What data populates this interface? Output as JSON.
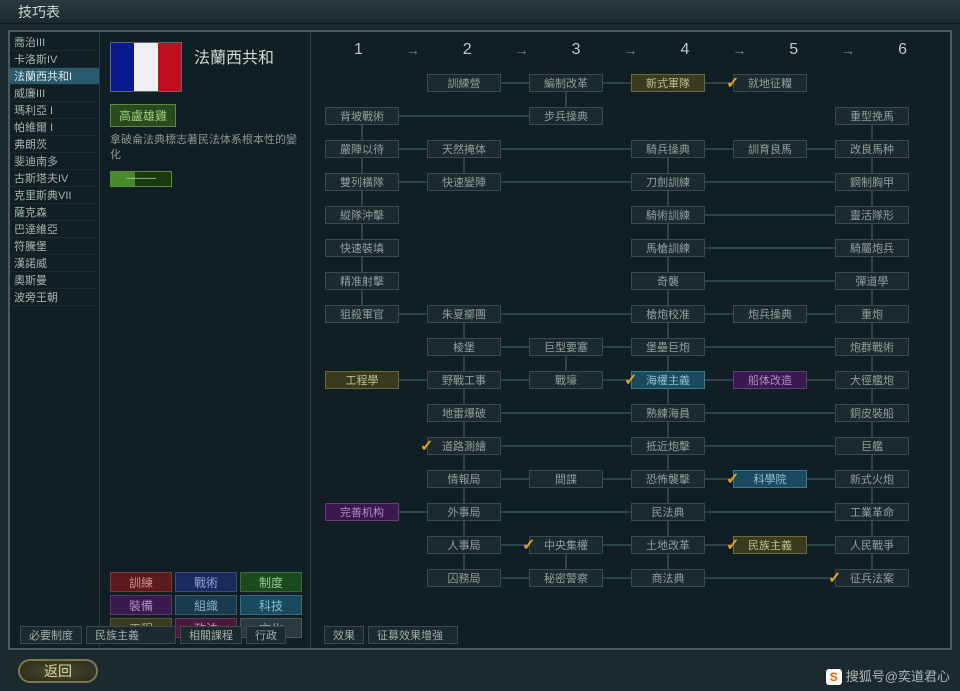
{
  "title": "技巧表",
  "back_label": "返回",
  "watermark": "搜狐号@奕道君心",
  "sidebar": {
    "items": [
      {
        "label": "喬治III"
      },
      {
        "label": "卡洛斯IV"
      },
      {
        "label": "法蘭西共和I",
        "selected": true
      },
      {
        "label": "威廉III"
      },
      {
        "label": "瑪利亞 I"
      },
      {
        "label": "帕維爾 I"
      },
      {
        "label": "弗朗茨"
      },
      {
        "label": "斐迪南多"
      },
      {
        "label": "古斯塔夫IV"
      },
      {
        "label": "克里斯典VII"
      },
      {
        "label": "薩克森"
      },
      {
        "label": "巴達維亞"
      },
      {
        "label": "符騰堡"
      },
      {
        "label": "漢諾威"
      },
      {
        "label": "奧斯曼"
      },
      {
        "label": "波旁王朝"
      }
    ]
  },
  "detail": {
    "nation_name": "法蘭西共和",
    "trait_label": "高盧雄雞",
    "trait_desc": "拿破侖法典標志著民法体系根本性的變化",
    "progress_text": "———"
  },
  "categories": [
    {
      "label": "訓練",
      "cls": "c-red"
    },
    {
      "label": "戰術",
      "cls": "c-blue"
    },
    {
      "label": "制度",
      "cls": "c-green"
    },
    {
      "label": "裝備",
      "cls": "c-purple"
    },
    {
      "label": "組織",
      "cls": "c-teal"
    },
    {
      "label": "科技",
      "cls": "c-cyan"
    },
    {
      "label": "工程",
      "cls": "c-olive"
    },
    {
      "label": "政法",
      "cls": "c-pink"
    },
    {
      "label": "文化",
      "cls": "c-grey"
    }
  ],
  "columns": [
    "1",
    "2",
    "3",
    "4",
    "5",
    "6"
  ],
  "techs": [
    {
      "label": "訓練營",
      "col": 2,
      "row": 0
    },
    {
      "label": "編制改革",
      "col": 3,
      "row": 0
    },
    {
      "label": "新式軍隊",
      "col": 4,
      "row": 0,
      "cls": "t-olive"
    },
    {
      "label": "就地征糧",
      "col": 5,
      "row": 0,
      "chk": true
    },
    {
      "label": "背坡戰術",
      "col": 1,
      "row": 1
    },
    {
      "label": "步兵操典",
      "col": 3,
      "row": 1
    },
    {
      "label": "重型挽馬",
      "col": 6,
      "row": 1
    },
    {
      "label": "嚴陣以待",
      "col": 1,
      "row": 2
    },
    {
      "label": "天然掩体",
      "col": 2,
      "row": 2
    },
    {
      "label": "騎兵操典",
      "col": 4,
      "row": 2
    },
    {
      "label": "訓育良馬",
      "col": 5,
      "row": 2
    },
    {
      "label": "改良馬种",
      "col": 6,
      "row": 2
    },
    {
      "label": "雙列橫隊",
      "col": 1,
      "row": 3
    },
    {
      "label": "快速變陣",
      "col": 2,
      "row": 3
    },
    {
      "label": "刀劍訓練",
      "col": 4,
      "row": 3
    },
    {
      "label": "鋼制胸甲",
      "col": 6,
      "row": 3
    },
    {
      "label": "縱隊沖擊",
      "col": 1,
      "row": 4
    },
    {
      "label": "騎術訓練",
      "col": 4,
      "row": 4
    },
    {
      "label": "靈活隊形",
      "col": 6,
      "row": 4
    },
    {
      "label": "快速裝填",
      "col": 1,
      "row": 5
    },
    {
      "label": "馬槍訓練",
      "col": 4,
      "row": 5
    },
    {
      "label": "騎屬炮兵",
      "col": 6,
      "row": 5
    },
    {
      "label": "精准射擊",
      "col": 1,
      "row": 6
    },
    {
      "label": "奇襲",
      "col": 4,
      "row": 6
    },
    {
      "label": "彈道學",
      "col": 6,
      "row": 6
    },
    {
      "label": "狙殺軍官",
      "col": 1,
      "row": 7
    },
    {
      "label": "朱夏擲團",
      "col": 2,
      "row": 7
    },
    {
      "label": "槍炮校准",
      "col": 4,
      "row": 7
    },
    {
      "label": "炮兵操典",
      "col": 5,
      "row": 7
    },
    {
      "label": "重炮",
      "col": 6,
      "row": 7
    },
    {
      "label": "棱堡",
      "col": 2,
      "row": 8
    },
    {
      "label": "巨型要塞",
      "col": 3,
      "row": 8
    },
    {
      "label": "堡壘巨炮",
      "col": 4,
      "row": 8
    },
    {
      "label": "炮群戰術",
      "col": 6,
      "row": 8
    },
    {
      "label": "工程學",
      "col": 1,
      "row": 9,
      "cls": "t-olive"
    },
    {
      "label": "野戰工事",
      "col": 2,
      "row": 9
    },
    {
      "label": "戰壕",
      "col": 3,
      "row": 9
    },
    {
      "label": "海權主義",
      "col": 4,
      "row": 9,
      "cls": "t-cyan",
      "chk": true
    },
    {
      "label": "船体改造",
      "col": 5,
      "row": 9,
      "cls": "t-purple"
    },
    {
      "label": "大徑艦炮",
      "col": 6,
      "row": 9
    },
    {
      "label": "地雷爆破",
      "col": 2,
      "row": 10
    },
    {
      "label": "熟練海員",
      "col": 4,
      "row": 10
    },
    {
      "label": "銅皮裝船",
      "col": 6,
      "row": 10
    },
    {
      "label": "道路測繪",
      "col": 2,
      "row": 11,
      "chk": true
    },
    {
      "label": "抵近炮擊",
      "col": 4,
      "row": 11
    },
    {
      "label": "巨艦",
      "col": 6,
      "row": 11
    },
    {
      "label": "情報局",
      "col": 2,
      "row": 12
    },
    {
      "label": "間諜",
      "col": 3,
      "row": 12
    },
    {
      "label": "恐怖襲擊",
      "col": 4,
      "row": 12
    },
    {
      "label": "科學院",
      "col": 5,
      "row": 12,
      "cls": "t-cyan",
      "chk": true
    },
    {
      "label": "新式火炮",
      "col": 6,
      "row": 12
    },
    {
      "label": "完善机构",
      "col": 1,
      "row": 13,
      "cls": "t-purple"
    },
    {
      "label": "外事局",
      "col": 2,
      "row": 13
    },
    {
      "label": "民法典",
      "col": 4,
      "row": 13
    },
    {
      "label": "工業革命",
      "col": 6,
      "row": 13
    },
    {
      "label": "人事局",
      "col": 2,
      "row": 14
    },
    {
      "label": "中央集權",
      "col": 3,
      "row": 14,
      "chk": true
    },
    {
      "label": "土地改革",
      "col": 4,
      "row": 14
    },
    {
      "label": "民族主義",
      "col": 5,
      "row": 14,
      "cls": "t-olive",
      "chk": true
    },
    {
      "label": "人民戰爭",
      "col": 6,
      "row": 14
    },
    {
      "label": "囚務局",
      "col": 2,
      "row": 15
    },
    {
      "label": "秘密警察",
      "col": 3,
      "row": 15
    },
    {
      "label": "商法典",
      "col": 4,
      "row": 15
    },
    {
      "label": "征兵法案",
      "col": 6,
      "row": 15,
      "chk": true
    }
  ],
  "bottom": {
    "req_label": "必要制度",
    "req_value": "民族主義",
    "rel_label": "相關課程",
    "rel_value": "行政",
    "eff_label": "效果",
    "eff_value": "征募效果增強"
  }
}
